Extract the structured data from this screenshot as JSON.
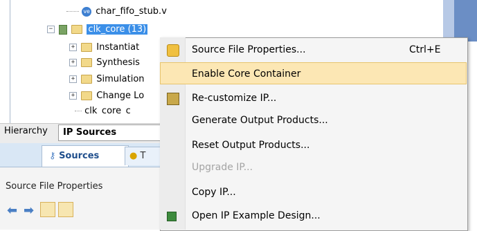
{
  "tree": {
    "rows": [
      {
        "label": "char_fifo_stub.v",
        "icon": "verilog-file-icon"
      },
      {
        "label": "clk_core (13)",
        "icon": "ip-core-icon"
      },
      {
        "label": "Instantiat"
      },
      {
        "label": "Synthesis"
      },
      {
        "label": "Simulation"
      },
      {
        "label": "Change Lo"
      },
      {
        "label": "clk_core_c"
      }
    ],
    "verilog_badge": "ve"
  },
  "hierarchy_bar": {
    "label": "Hierarchy",
    "active_tab": "IP Sources"
  },
  "bottom_tabs": {
    "sources": "Sources",
    "second": "T"
  },
  "properties": {
    "title": "Source File Properties"
  },
  "context_menu": {
    "items": [
      {
        "label": "Source File Properties...",
        "shortcut": "Ctrl+E",
        "icon": "properties-icon"
      },
      {
        "label": "Enable Core Container",
        "highlighted": true
      },
      {
        "label": "Re-customize IP...",
        "icon": "customize-ip-icon"
      },
      {
        "label": "Generate Output Products..."
      },
      {
        "label": "Reset Output Products..."
      },
      {
        "label": "Upgrade IP...",
        "disabled": true
      },
      {
        "label": "Copy IP..."
      },
      {
        "label": "Open IP Example Design...",
        "icon": "example-design-icon"
      }
    ]
  },
  "colors": {
    "selection": "#3b8fe8",
    "menu_highlight": "#fce7b4",
    "disabled_text": "#a4a4a4"
  }
}
